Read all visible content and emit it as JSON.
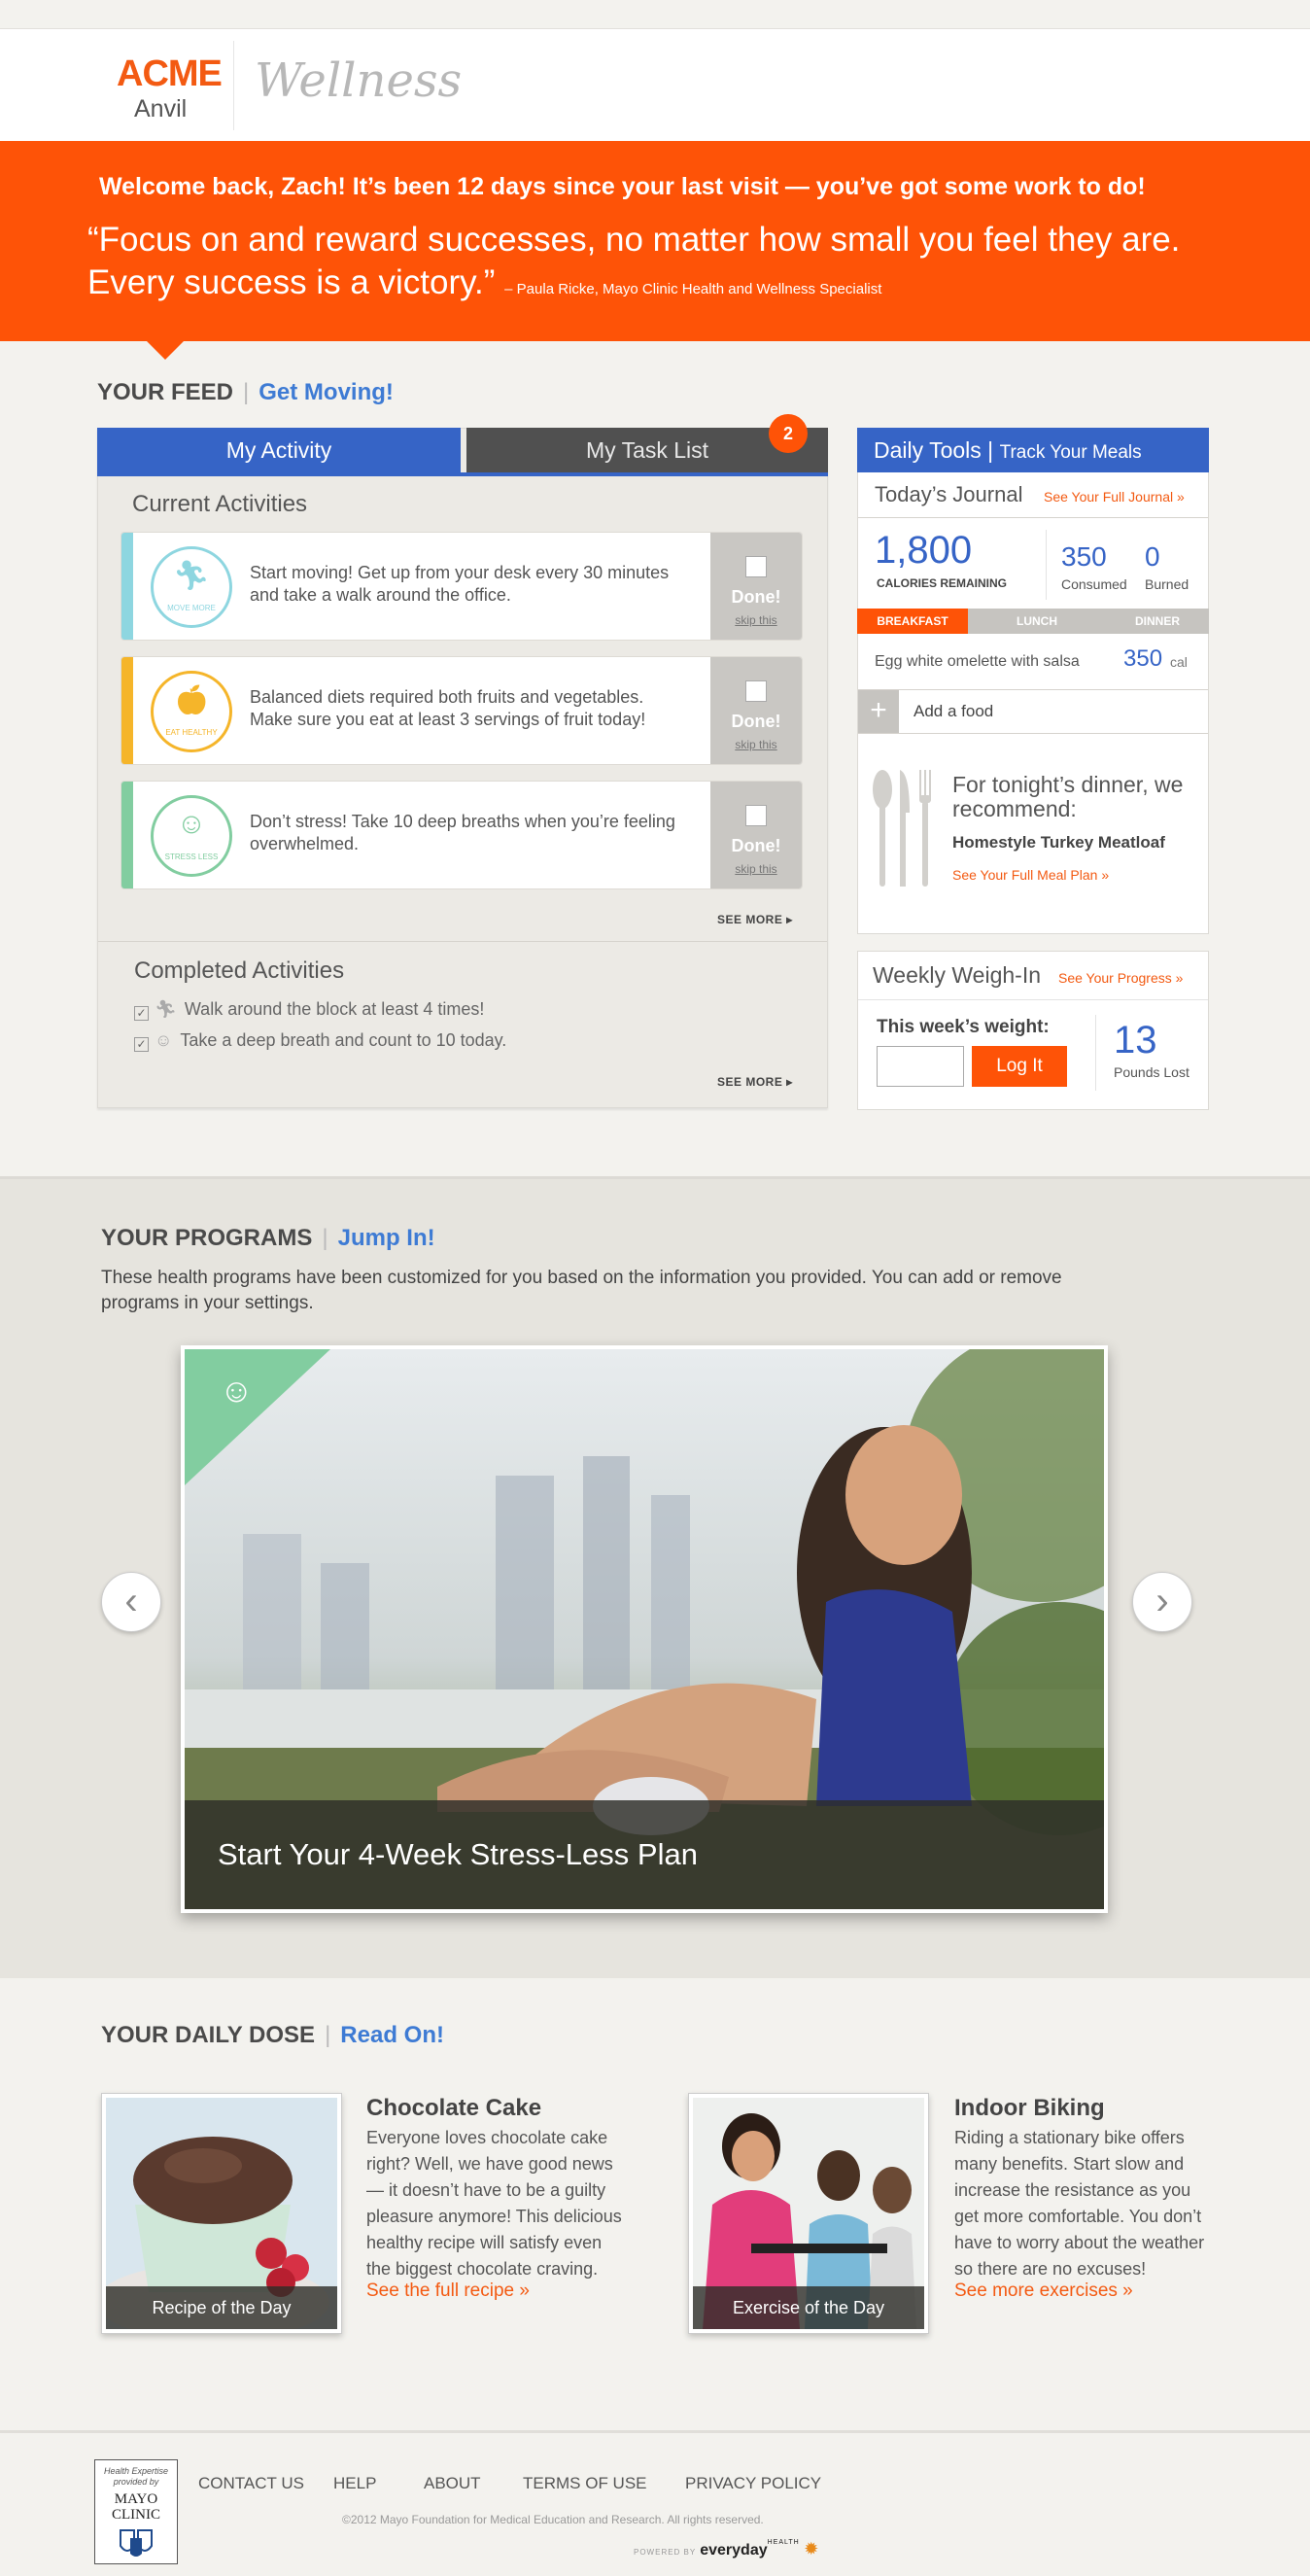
{
  "brand": {
    "acme": "ACME",
    "anvil": "Anvil",
    "product": "Wellness"
  },
  "banner": {
    "welcome": "Welcome back, Zach! It’s been 12 days since your last visit — you’ve got some work to do!",
    "quote": "“Focus on and reward successes, no matter how small you feel they are. Every success is a victory.”",
    "author": "– Paula Ricke, Mayo Clinic Health and Wellness Specialist",
    "color": "#fe5307"
  },
  "feed": {
    "title": "YOUR FEED",
    "accent": "Get Moving!",
    "tab_activity": "My Activity",
    "tab_tasks": "My Task List",
    "task_count": "2",
    "current_heading": "Current Activities",
    "activities": [
      {
        "icon": "running-man-icon",
        "label": "MOVE MORE",
        "text": "Start moving! Get up from your desk every 30 minutes and take a walk around the office.",
        "color": "#8ed6e0"
      },
      {
        "icon": "apple-icon",
        "label": "EAT HEALTHY",
        "text": "Balanced diets required both fruits and vegetables. Make sure you eat at least 3 servings of fruit today!",
        "color": "#f5b52a"
      },
      {
        "icon": "meditation-icon",
        "label": "STRESS LESS",
        "text": "Don’t stress! Take 10 deep breaths when you’re feeling overwhelmed.",
        "color": "#82cda0"
      }
    ],
    "done_label": "Done!",
    "skip_label": "skip this",
    "see_more": "SEE MORE",
    "completed_heading": "Completed Activities",
    "completed": [
      {
        "icon": "running-man-icon",
        "text": "Walk around the block at least 4 times!"
      },
      {
        "icon": "meditation-icon",
        "text": "Take a deep breath and count to 10 today."
      }
    ]
  },
  "tools": {
    "title": "Daily Tools",
    "subtitle": "Track Your Meals",
    "journal": "Today’s Journal",
    "journal_link": "See Your Full Journal »",
    "calories_remaining": "1,800",
    "calories_label": "CALORIES REMAINING",
    "consumed": "350",
    "consumed_label": "Consumed",
    "burned": "0",
    "burned_label": "Burned",
    "meal_tabs": [
      "BREAKFAST",
      "LUNCH",
      "DINNER"
    ],
    "food_item": "Egg white omelette with salsa",
    "food_cal": "350",
    "cal_unit": "cal",
    "add_food": "Add a food",
    "dinner_intro": "For tonight’s dinner, we recommend:",
    "dinner_name": "Homestyle Turkey Meatloaf",
    "dinner_link": "See Your Full Meal Plan »"
  },
  "weigh": {
    "title": "Weekly Weigh-In",
    "link": "See Your Progress »",
    "prompt": "This week’s weight:",
    "button": "Log It",
    "lost": "13",
    "lost_label": "Pounds Lost"
  },
  "programs": {
    "title": "YOUR PROGRAMS",
    "accent": "Jump In!",
    "desc": "These health programs have been customized for you based on the information you provided. You can add or remove programs in your settings.",
    "slide_caption": "Start Your 4-Week Stress-Less Plan"
  },
  "dose": {
    "title": "YOUR DAILY DOSE",
    "accent": "Read On!",
    "items": [
      {
        "caption": "Recipe of the Day",
        "heading": "Chocolate Cake",
        "body": "Everyone loves chocolate cake right? Well, we have good news — it doesn’t have to be a guilty pleasure anymore! This delicious healthy recipe will satisfy even the biggest chocolate craving.",
        "link": "See the full recipe »"
      },
      {
        "caption": "Exercise of the Day",
        "heading": "Indoor Biking",
        "body": "Riding a stationary bike offers many benefits. Start slow and increase the resistance as you get more comfortable. You don’t have to worry about the weather so there are no excuses!",
        "link": "See more exercises »"
      }
    ]
  },
  "footer": {
    "mayo_tag": "Health Expertise provided by",
    "mayo_name": "MAYO CLINIC",
    "links": [
      "CONTACT US",
      "HELP",
      "ABOUT",
      "TERMS OF USE",
      "PRIVACY POLICY"
    ],
    "copyright": "©2012 Mayo Foundation for Medical Education and Research. All rights reserved.",
    "powered": "POWERED BY",
    "powered_brand": "everyday",
    "powered_sup": "HEALTH"
  }
}
